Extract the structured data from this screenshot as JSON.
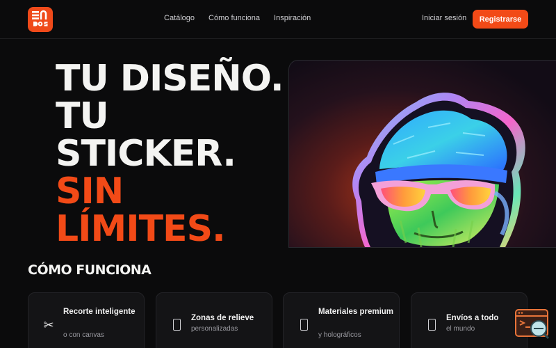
{
  "brand": {
    "logo_text": "EN DOS",
    "accent": "#f24a17"
  },
  "nav": {
    "links": [
      "Catálogo",
      "Cómo funciona",
      "Inspiración"
    ],
    "login_label": "Iniciar sesión",
    "signup_label": "Registrarse"
  },
  "hero": {
    "lines": [
      "TU DISEÑO.",
      "TU",
      "STICKER.",
      "SIN",
      "LÍMITES."
    ],
    "image_subject": "holographic sticker of a bearded man with beanie and sunglasses",
    "image_icon": "sticker-illustration"
  },
  "how_it_works": {
    "title": "CÓMO FUNCIONA",
    "features": [
      {
        "icon": "scissors-icon",
        "title": "Recorte inteligente",
        "subtitle": "o con canvas"
      },
      {
        "icon": "box-icon",
        "title": "Zonas de relieve",
        "subtitle": "personalizadas"
      },
      {
        "icon": "box-icon",
        "title": "Materiales premium",
        "subtitle": "y holográficos"
      },
      {
        "icon": "box-icon",
        "title": "Envíos a todo",
        "subtitle": "el mundo"
      }
    ]
  }
}
